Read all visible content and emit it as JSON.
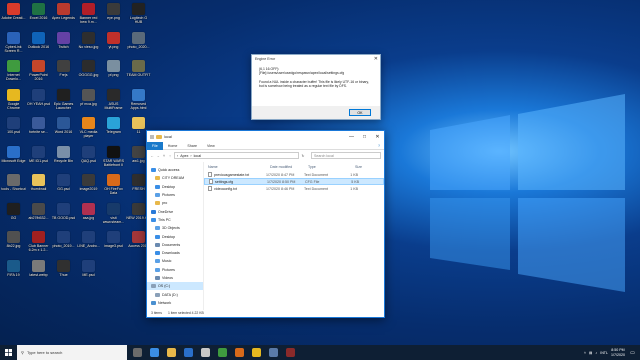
{
  "desktop": {
    "icons": [
      {
        "label": "Adobe Creati...",
        "color": "#d83b2b"
      },
      {
        "label": "Excel 2016",
        "color": "#1f7244"
      },
      {
        "label": "Apex Legends",
        "color": "#b83a2e"
      },
      {
        "label": "Banner red bew 9.m...",
        "color": "#b01e28"
      },
      {
        "label": "eye.png",
        "color": "#3a3a3a"
      },
      {
        "label": "Logitech G HUB",
        "color": "#222222"
      },
      {
        "label": "CyberLink Screen R...",
        "color": "#2a62b8"
      },
      {
        "label": "Outlook 2016",
        "color": "#0f63b8"
      },
      {
        "label": "Twitch",
        "color": "#6441a5"
      },
      {
        "label": "No vieso.jpg",
        "color": "#2e2e2e"
      },
      {
        "label": "yt.png",
        "color": "#c0302a"
      },
      {
        "label": "photo_2020...",
        "color": "#5a6a7a"
      },
      {
        "label": "Internet Downlo...",
        "color": "#3f9b3f"
      },
      {
        "label": "PowerPoint 2016",
        "color": "#c4462a"
      },
      {
        "label": "Frejs",
        "color": "#404040"
      },
      {
        "label": "OGGGG.jpg",
        "color": "#2c2c2c"
      },
      {
        "label": "pf.png",
        "color": "#7a8fa0"
      },
      {
        "label": "TEAM OUTFIT",
        "color": "#6a6a4a"
      },
      {
        "label": "Google Chrome",
        "color": "#e6b820"
      },
      {
        "label": "OH YEAH.psd",
        "color": "#1f3f7a"
      },
      {
        "label": "Epic Games Launcher",
        "color": "#202020"
      },
      {
        "label": "pf mca.jpg",
        "color": "#555555"
      },
      {
        "label": "ASUS MultiFrame",
        "color": "#2a2a2a"
      },
      {
        "label": "Removed Apps.html",
        "color": "#3579c8"
      },
      {
        "label": "100.psd",
        "color": "#1f3f7a"
      },
      {
        "label": "fortnite se...",
        "color": "#3a5a9a"
      },
      {
        "label": "Word 2016",
        "color": "#2b5797"
      },
      {
        "label": "VLC media player",
        "color": "#e8861a"
      },
      {
        "label": "Telegram",
        "color": "#2aa3d8"
      },
      {
        "label": "11",
        "color": "#e8c25a"
      },
      {
        "label": "Microsoft Edge",
        "color": "#2a6fc9"
      },
      {
        "label": "ME ID1.psd",
        "color": "#1f3f7a"
      },
      {
        "label": "Recycle Bin",
        "color": "#7a8fa8"
      },
      {
        "label": "QAQ.psd",
        "color": "#1f3f7a"
      },
      {
        "label": "STAR WARS Battlefront II",
        "color": "#111111"
      },
      {
        "label": "aw1.jpg",
        "color": "#444444"
      },
      {
        "label": "tools - Shortcut",
        "color": "#6a6a6a"
      },
      {
        "label": "thumbnail",
        "color": "#e8c25a"
      },
      {
        "label": "GG.psd",
        "color": "#1f3f7a"
      },
      {
        "label": "image2019",
        "color": "#3a3a3a"
      },
      {
        "label": "OH FireFox Data",
        "color": "#d86a1a"
      },
      {
        "label": "FRESH",
        "color": "#2f2f2f"
      },
      {
        "label": "GG",
        "color": "#1f1f1f"
      },
      {
        "label": "ab27fb532...",
        "color": "#4a4a4a"
      },
      {
        "label": "TB GOOD.psd",
        "color": "#1f3f7a"
      },
      {
        "label": "asa.jpg",
        "color": "#b03050"
      },
      {
        "label": "visit www.steam...",
        "color": "#173a6a"
      },
      {
        "label": "NEW 2019.ht...",
        "color": "#3a3a3a"
      },
      {
        "label": "8b22.jpg",
        "color": "#505050"
      },
      {
        "label": "Club Banner 6.2m x 1.2...",
        "color": "#a02020"
      },
      {
        "label": "photo_2019...",
        "color": "#1f3f7a"
      },
      {
        "label": "LINE_Andro...",
        "color": "#1f3f7a"
      },
      {
        "label": "image3.psd",
        "color": "#1f3f7a"
      },
      {
        "label": "Access 2016",
        "color": "#a4373a"
      },
      {
        "label": "FIFA 19",
        "color": "#1a5a8a"
      },
      {
        "label": "latest.webp",
        "color": "#7a7a7a"
      },
      {
        "label": "Thue",
        "color": "#303030"
      },
      {
        "label": "ME.psd",
        "color": "#1f3f7a"
      }
    ]
  },
  "dialog": {
    "title": "Engine Error",
    "message": "(6,1 16.OFF):\n[File]:/users/user/usedgo/respawn/apex/local/settings.cfg\n\nFound a NUL inside a character buffer! This file is likely UTF-16 or binary, but is somehow being treated as a regular text file by DFS.",
    "ok_label": "OK",
    "close_glyph": "✕"
  },
  "explorer": {
    "title": "local",
    "tabs": [
      "File",
      "Home",
      "Share",
      "View"
    ],
    "help_glyph": "?",
    "address": [
      "Apex",
      "local"
    ],
    "search_placeholder": "Search local",
    "nav": [
      {
        "label": "Quick access",
        "color": "#3a8ee6"
      },
      {
        "label": "CITY DREAM",
        "color": "#e8b84a"
      },
      {
        "label": "Desktop",
        "color": "#3a8ee6"
      },
      {
        "label": "Pictures",
        "color": "#5aa0e6"
      },
      {
        "label": "pro",
        "color": "#e8b84a"
      },
      {
        "label": "OneDrive",
        "color": "#2a7ad8"
      },
      {
        "label": "This PC",
        "color": "#3a8ee6"
      },
      {
        "label": "3D Objects",
        "color": "#5aa0e6"
      },
      {
        "label": "Desktop",
        "color": "#3a8ee6"
      },
      {
        "label": "Documents",
        "color": "#6a8ab0"
      },
      {
        "label": "Downloads",
        "color": "#3a8ee6"
      },
      {
        "label": "Music",
        "color": "#5aa0e6"
      },
      {
        "label": "Pictures",
        "color": "#5aa0e6"
      },
      {
        "label": "Videos",
        "color": "#6a8ab0"
      },
      {
        "label": "OS (C:)",
        "color": "#8aa0b8"
      },
      {
        "label": "DATA (D:)",
        "color": "#8aa0b8"
      },
      {
        "label": "Network",
        "color": "#4a90d0"
      }
    ],
    "selected_nav": 14,
    "columns": {
      "name": "Name",
      "date": "Date modified",
      "type": "Type",
      "size": "Size"
    },
    "files": [
      {
        "name": "previousgamestate.txt",
        "date": "1/7/2020 8:47 PM",
        "type": "Text Document",
        "size": "1 KB"
      },
      {
        "name": "settings.cfg",
        "date": "1/7/2020 8:50 PM",
        "type": "CFG File",
        "size": "5 KB"
      },
      {
        "name": "videoconfig.txt",
        "date": "1/7/2020 8:46 PM",
        "type": "Text Document",
        "size": "1 KB"
      }
    ],
    "selected_file": 1,
    "status_items": "3 items",
    "status_selected": "1 item selected 4.22 KB"
  },
  "taskbar": {
    "search_placeholder": "Type here to search",
    "time": "8:50 PM",
    "date": "1/7/2020",
    "lang": "INTL",
    "pinned_colors": [
      "#6b6b6b",
      "#3a8ee6",
      "#e8b84a",
      "#2a6fc9",
      "#c8c8c8",
      "#3f9b3f",
      "#d86a1a",
      "#e6b820",
      "#5a7aa8",
      "#8a2a2a"
    ]
  }
}
